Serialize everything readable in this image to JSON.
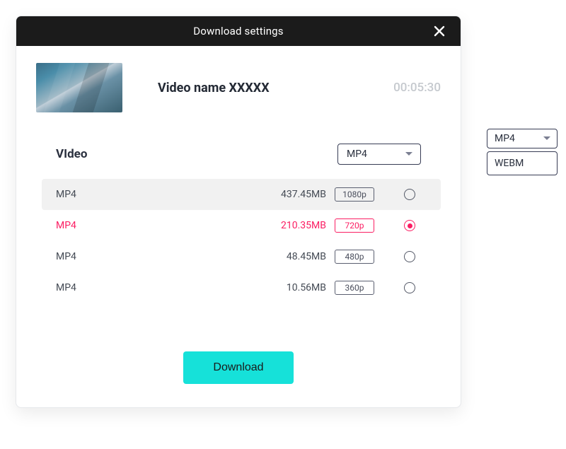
{
  "dialog": {
    "title": "Download settings",
    "video_name": "Video name XXXXX",
    "duration": "00:05:30",
    "section_label": "VIdeo",
    "format_selected": "MP4",
    "download_label": "Download"
  },
  "options": [
    {
      "format": "MP4",
      "size": "437.45MB",
      "resolution": "1080p",
      "selected": false
    },
    {
      "format": "MP4",
      "size": "210.35MB",
      "resolution": "720p",
      "selected": true
    },
    {
      "format": "MP4",
      "size": "48.45MB",
      "resolution": "480p",
      "selected": false
    },
    {
      "format": "MP4",
      "size": "10.56MB",
      "resolution": "360p",
      "selected": false
    }
  ],
  "side_panel": {
    "selected": "MP4",
    "items": [
      "WEBM"
    ]
  },
  "colors": {
    "accent": "#16e1d9",
    "selected": "#fb1e63"
  }
}
